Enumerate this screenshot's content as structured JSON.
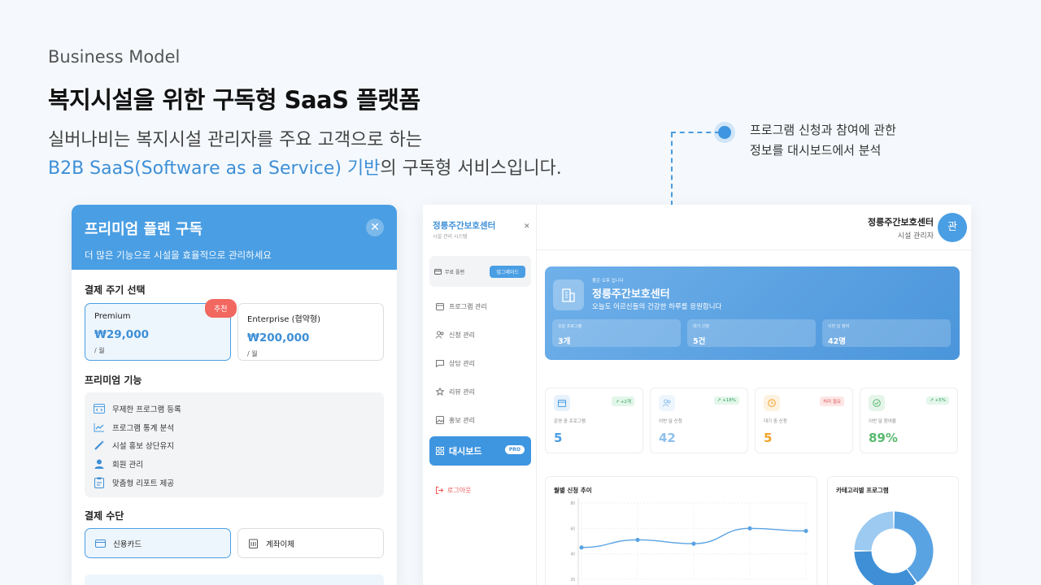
{
  "slide": {
    "eyebrow": "Business Model",
    "headline": "복지시설을 위한 구독형 SaaS 플랫폼",
    "subtitle_line1": "실버나비는 복지시설 관리자를 주요 고객으로 하는",
    "subtitle_line2_accent": "B2B SaaS(Software as a Service) 기반",
    "subtitle_line2_rest": "의 구독형 서비스입니다.",
    "callout_line1": "프로그램 신청과 참여에 관한",
    "callout_line2": "정보를 대시보드에서 분석"
  },
  "modal": {
    "title": "프리미엄 플랜 구독",
    "description": "더 많은 기능으로 시설을 효율적으로 관리하세요",
    "close_icon": "close-icon",
    "billing_title": "결제 주기 선택",
    "recommend_badge": "추천",
    "plans": [
      {
        "name": "Premium",
        "price": "₩29,000",
        "per": "/ 월",
        "selected": true
      },
      {
        "name": "Enterprise (협약형)",
        "price": "₩200,000",
        "per": "/ 월",
        "selected": false
      }
    ],
    "features_title": "프리미엄 기능",
    "features": [
      {
        "icon": "code-window-icon",
        "label": "무제한 프로그램 등록"
      },
      {
        "icon": "trend-chart-icon",
        "label": "프로그램 통계 분석"
      },
      {
        "icon": "magic-wand-icon",
        "label": "시설 홍보 상단유지"
      },
      {
        "icon": "user-icon",
        "label": "회원 관리"
      },
      {
        "icon": "clipboard-icon",
        "label": "맞춤형 리포트 제공"
      }
    ],
    "payment_title": "결제 수단",
    "payments": [
      {
        "icon": "credit-card-icon",
        "label": "신용카드",
        "selected": true
      },
      {
        "icon": "bank-icon",
        "label": "계좌이체",
        "selected": false
      }
    ]
  },
  "app": {
    "sidebar": {
      "brand": "정릉주간보호센터",
      "brand_sub": "시설 관리 시스템",
      "plan_label": "무료 플랜",
      "upgrade_label": "업그레이드",
      "nav": [
        {
          "icon": "calendar-icon",
          "label": "프로그램 관리"
        },
        {
          "icon": "users-icon",
          "label": "신청 관리"
        },
        {
          "icon": "chat-icon",
          "label": "상담 관리"
        },
        {
          "icon": "star-icon",
          "label": "리뷰 관리"
        },
        {
          "icon": "image-icon",
          "label": "홍보 관리"
        }
      ],
      "active_label": "대시보드",
      "active_badge": "PRO",
      "logout_label": "로그아웃"
    },
    "topbar": {
      "name": "정릉주간보호센터",
      "role": "시설 관리자",
      "avatar": "관"
    },
    "hero": {
      "small": "좋은 오후 입니다",
      "title": "정릉주간보호센터",
      "subtitle": "오늘도 어르신들의 건강한 하루를 응원합니다",
      "stats": [
        {
          "label": "오늘 프로그램",
          "value": "3개"
        },
        {
          "label": "대기 신청",
          "value": "5건"
        },
        {
          "label": "이번 달 참여",
          "value": "42명"
        }
      ]
    },
    "cards": [
      {
        "icon": "calendar-icon",
        "change": "+2개",
        "label": "운영 중 프로그램",
        "value": "5",
        "color": "#4a9ee3",
        "bg": "#e6f1fc",
        "chg_color": "#2e9e57",
        "chg_bg": "#e3f6ea"
      },
      {
        "icon": "users-icon",
        "change": "+18%",
        "label": "이번 달 신청",
        "value": "42",
        "color": "#8fc0ec",
        "bg": "#eef5fc",
        "chg_color": "#2e9e57",
        "chg_bg": "#e3f6ea"
      },
      {
        "icon": "clock-icon",
        "change": "처리 필요",
        "label": "대기 중 신청",
        "value": "5",
        "color": "#f0a229",
        "bg": "#fdf2e0",
        "chg_color": "#e05454",
        "chg_bg": "#fde6e6"
      },
      {
        "icon": "check-circle-icon",
        "change": "+5%",
        "label": "이번 달 참여율",
        "value": "89%",
        "color": "#59b96e",
        "bg": "#e6f5ea",
        "chg_color": "#2e9e57",
        "chg_bg": "#e3f6ea"
      }
    ],
    "line_panel_title": "월별 신청 추이",
    "donut_panel_title": "카테고리별 프로그램"
  },
  "chart_data": [
    {
      "type": "line",
      "title": "월별 신청 추이",
      "x": [
        "",
        "",
        "",
        "",
        ""
      ],
      "series": [
        {
          "values": [
            45,
            51,
            48,
            60,
            58
          ]
        }
      ],
      "yticks": [
        "80",
        "60",
        "40",
        "20"
      ],
      "ylim": [
        20,
        80
      ],
      "grid": true,
      "color": "#5aa3e3"
    },
    {
      "type": "pie",
      "title": "카테고리별 프로그램",
      "values": [
        40,
        35,
        25
      ],
      "colors": [
        "#5aa3e3",
        "#3e8fd6",
        "#9ccaf1"
      ]
    }
  ]
}
